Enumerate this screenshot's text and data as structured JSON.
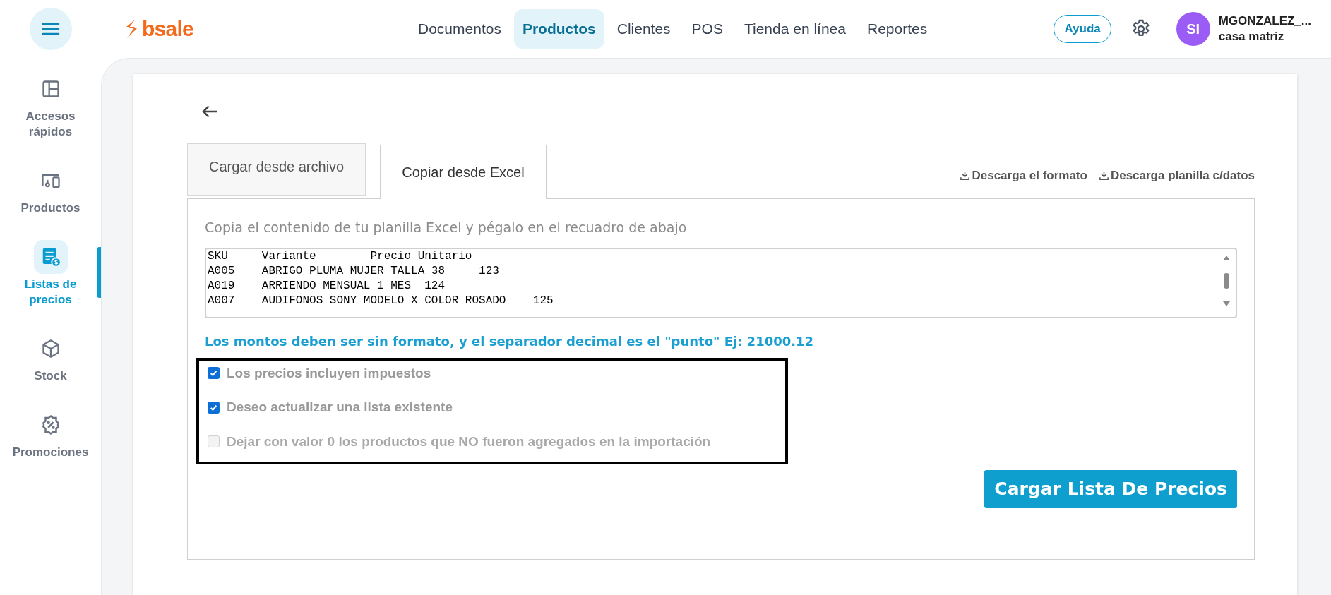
{
  "header": {
    "logo": "bsale",
    "nav": [
      {
        "label": "Documentos",
        "selected": false
      },
      {
        "label": "Productos",
        "selected": true
      },
      {
        "label": "Clientes",
        "selected": false
      },
      {
        "label": "POS",
        "selected": false
      },
      {
        "label": "Tienda en línea",
        "selected": false
      },
      {
        "label": "Reportes",
        "selected": false
      }
    ],
    "help": "Ayuda",
    "user": {
      "initials": "SI",
      "name": "MGONZALEZ_...",
      "branch": "casa matriz"
    }
  },
  "sidebar": {
    "items": [
      {
        "kind": "quick",
        "label": "Accesos rápidos",
        "selected": false
      },
      {
        "kind": "products",
        "label": "Productos",
        "selected": false
      },
      {
        "kind": "prices",
        "label": "Listas de precios",
        "selected": true
      },
      {
        "kind": "stock",
        "label": "Stock",
        "selected": false
      },
      {
        "kind": "promo",
        "label": "Promociones",
        "selected": false
      }
    ]
  },
  "tabs": [
    {
      "label": "Cargar desde archivo",
      "selected": false
    },
    {
      "label": "Copiar desde Excel",
      "selected": true
    }
  ],
  "downloads": [
    "Descarga el formato",
    "Descarga planilla c/datos"
  ],
  "instructions": "Copia el contenido de tu planilla Excel y pégalo en el recuadro de abajo",
  "paste_box": {
    "value": "SKU     Variante        Precio Unitario\nA005    ABRIGO PLUMA MUJER TALLA 38     123\nA019    ARRIENDO MENSUAL 1 MES  124\nA007    AUDIFONOS SONY MODELO X COLOR ROSADO    125"
  },
  "note": "Los montos deben ser sin formato, y el separador decimal es el \"punto\" Ej: 21000.12",
  "options": [
    {
      "label": "Los precios incluyen impuestos",
      "checked": true,
      "disabled": false
    },
    {
      "label": "Deseo actualizar una lista existente",
      "checked": true,
      "disabled": false
    },
    {
      "label": "Dejar con valor 0 los productos que NO fueron agregados en la importación",
      "checked": false,
      "disabled": true
    }
  ],
  "submit": "Cargar Lista De Precios"
}
